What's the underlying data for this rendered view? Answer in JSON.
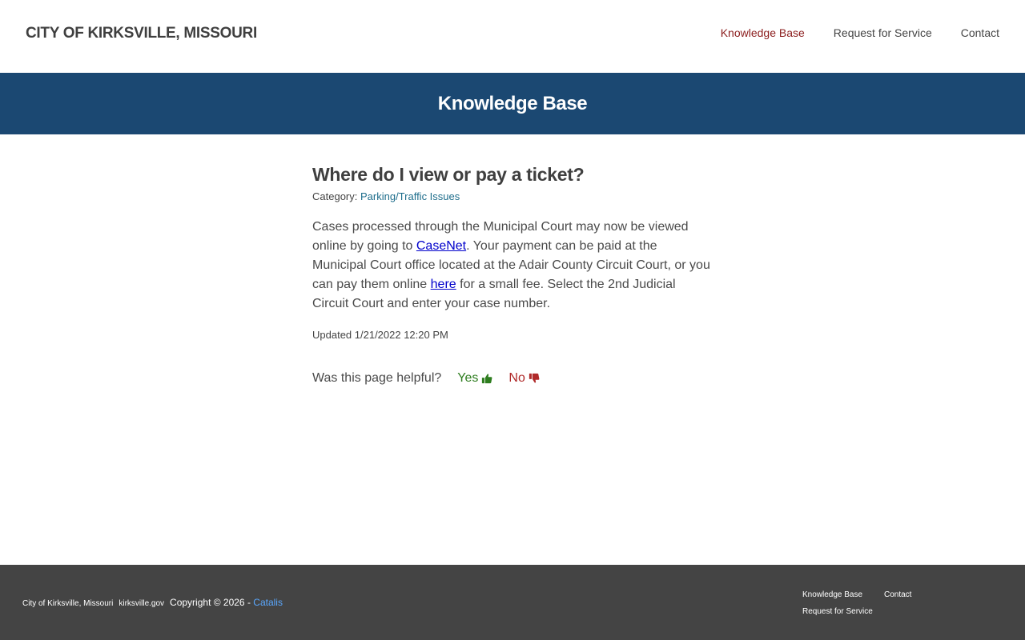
{
  "header": {
    "site_title": "CITY OF KIRKSVILLE, MISSOURI",
    "nav": [
      {
        "label": "Knowledge Base",
        "active": true
      },
      {
        "label": "Request for Service",
        "active": false
      },
      {
        "label": "Contact",
        "active": false
      }
    ]
  },
  "banner": {
    "title": "Knowledge Base"
  },
  "article": {
    "title": "Where do I view or pay a ticket?",
    "category_prefix": "Category: ",
    "category_link": "Parking/Traffic Issues",
    "body": {
      "part1": "Cases processed through the Municipal Court may now be viewed online by going to ",
      "link1": "CaseNet",
      "part2": ".  Your payment can be paid at the Municipal Court office located at the Adair County Circuit Court, or you can pay them online ",
      "link2": "here",
      "part3": " for a small fee. Select the 2nd Judicial Circuit Court and enter your case number."
    },
    "updated": "Updated 1/21/2022 12:20 PM",
    "helpful": {
      "question": "Was this page helpful?",
      "yes_label": "Yes",
      "no_label": "No"
    }
  },
  "footer": {
    "city_name": "City of Kirksville, Missouri",
    "domain": "kirksville.gov",
    "copyright": "Copyright © 2026 - ",
    "vendor_link": "Catalis",
    "nav": {
      "knowledge_base": "Knowledge Base",
      "contact": "Contact",
      "request_for_service": "Request for Service"
    }
  },
  "colors": {
    "banner_bg": "#1b4872",
    "footer_bg": "#444444",
    "active_nav": "#8b1d1d",
    "category_link": "#1f6e8c",
    "body_link": "#0000cc",
    "yes": "#2e7d1f",
    "no": "#b02a2a",
    "vendor_link": "#5aa8ff"
  },
  "icons": {
    "yes": "thumbs-up-icon",
    "no": "thumbs-down-icon"
  }
}
